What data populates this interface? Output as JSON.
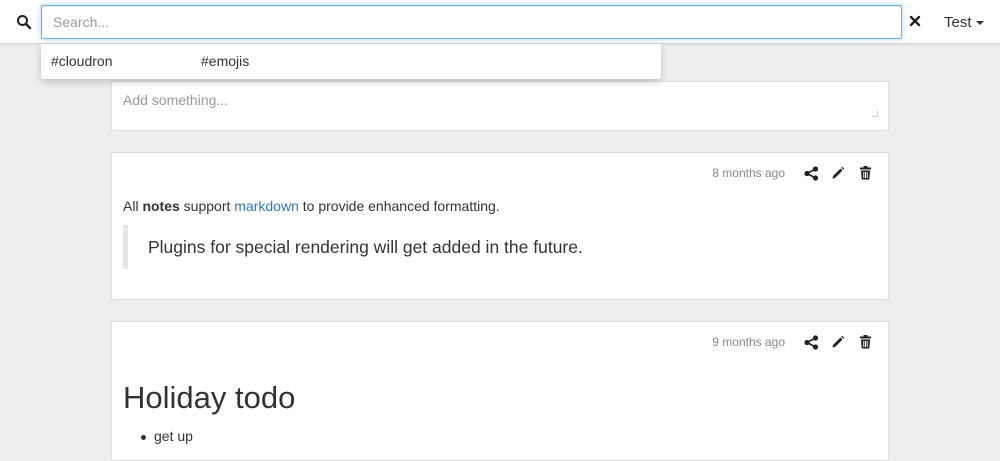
{
  "header": {
    "search_placeholder": "Search...",
    "user_label": "Test"
  },
  "search_suggestions": [
    "#cloudron",
    "#emojis"
  ],
  "composer": {
    "placeholder": "Add something..."
  },
  "notes": [
    {
      "timestamp": "8 months ago",
      "text_before": "All ",
      "text_bold": "notes",
      "text_mid": " support ",
      "link_text": "markdown",
      "text_after": " to provide enhanced formatting.",
      "quote": "Plugins for special rendering will get added in the future."
    },
    {
      "timestamp": "9 months ago",
      "heading": "Holiday todo",
      "items": [
        "get up"
      ]
    }
  ],
  "colors": {
    "link": "#337ab7",
    "focus_border": "#66afe9",
    "background": "#eeeeee"
  },
  "icons": {
    "search": "search-icon",
    "clear": "close-icon",
    "share": "share-icon",
    "edit": "pencil-icon",
    "delete": "trash-icon"
  }
}
